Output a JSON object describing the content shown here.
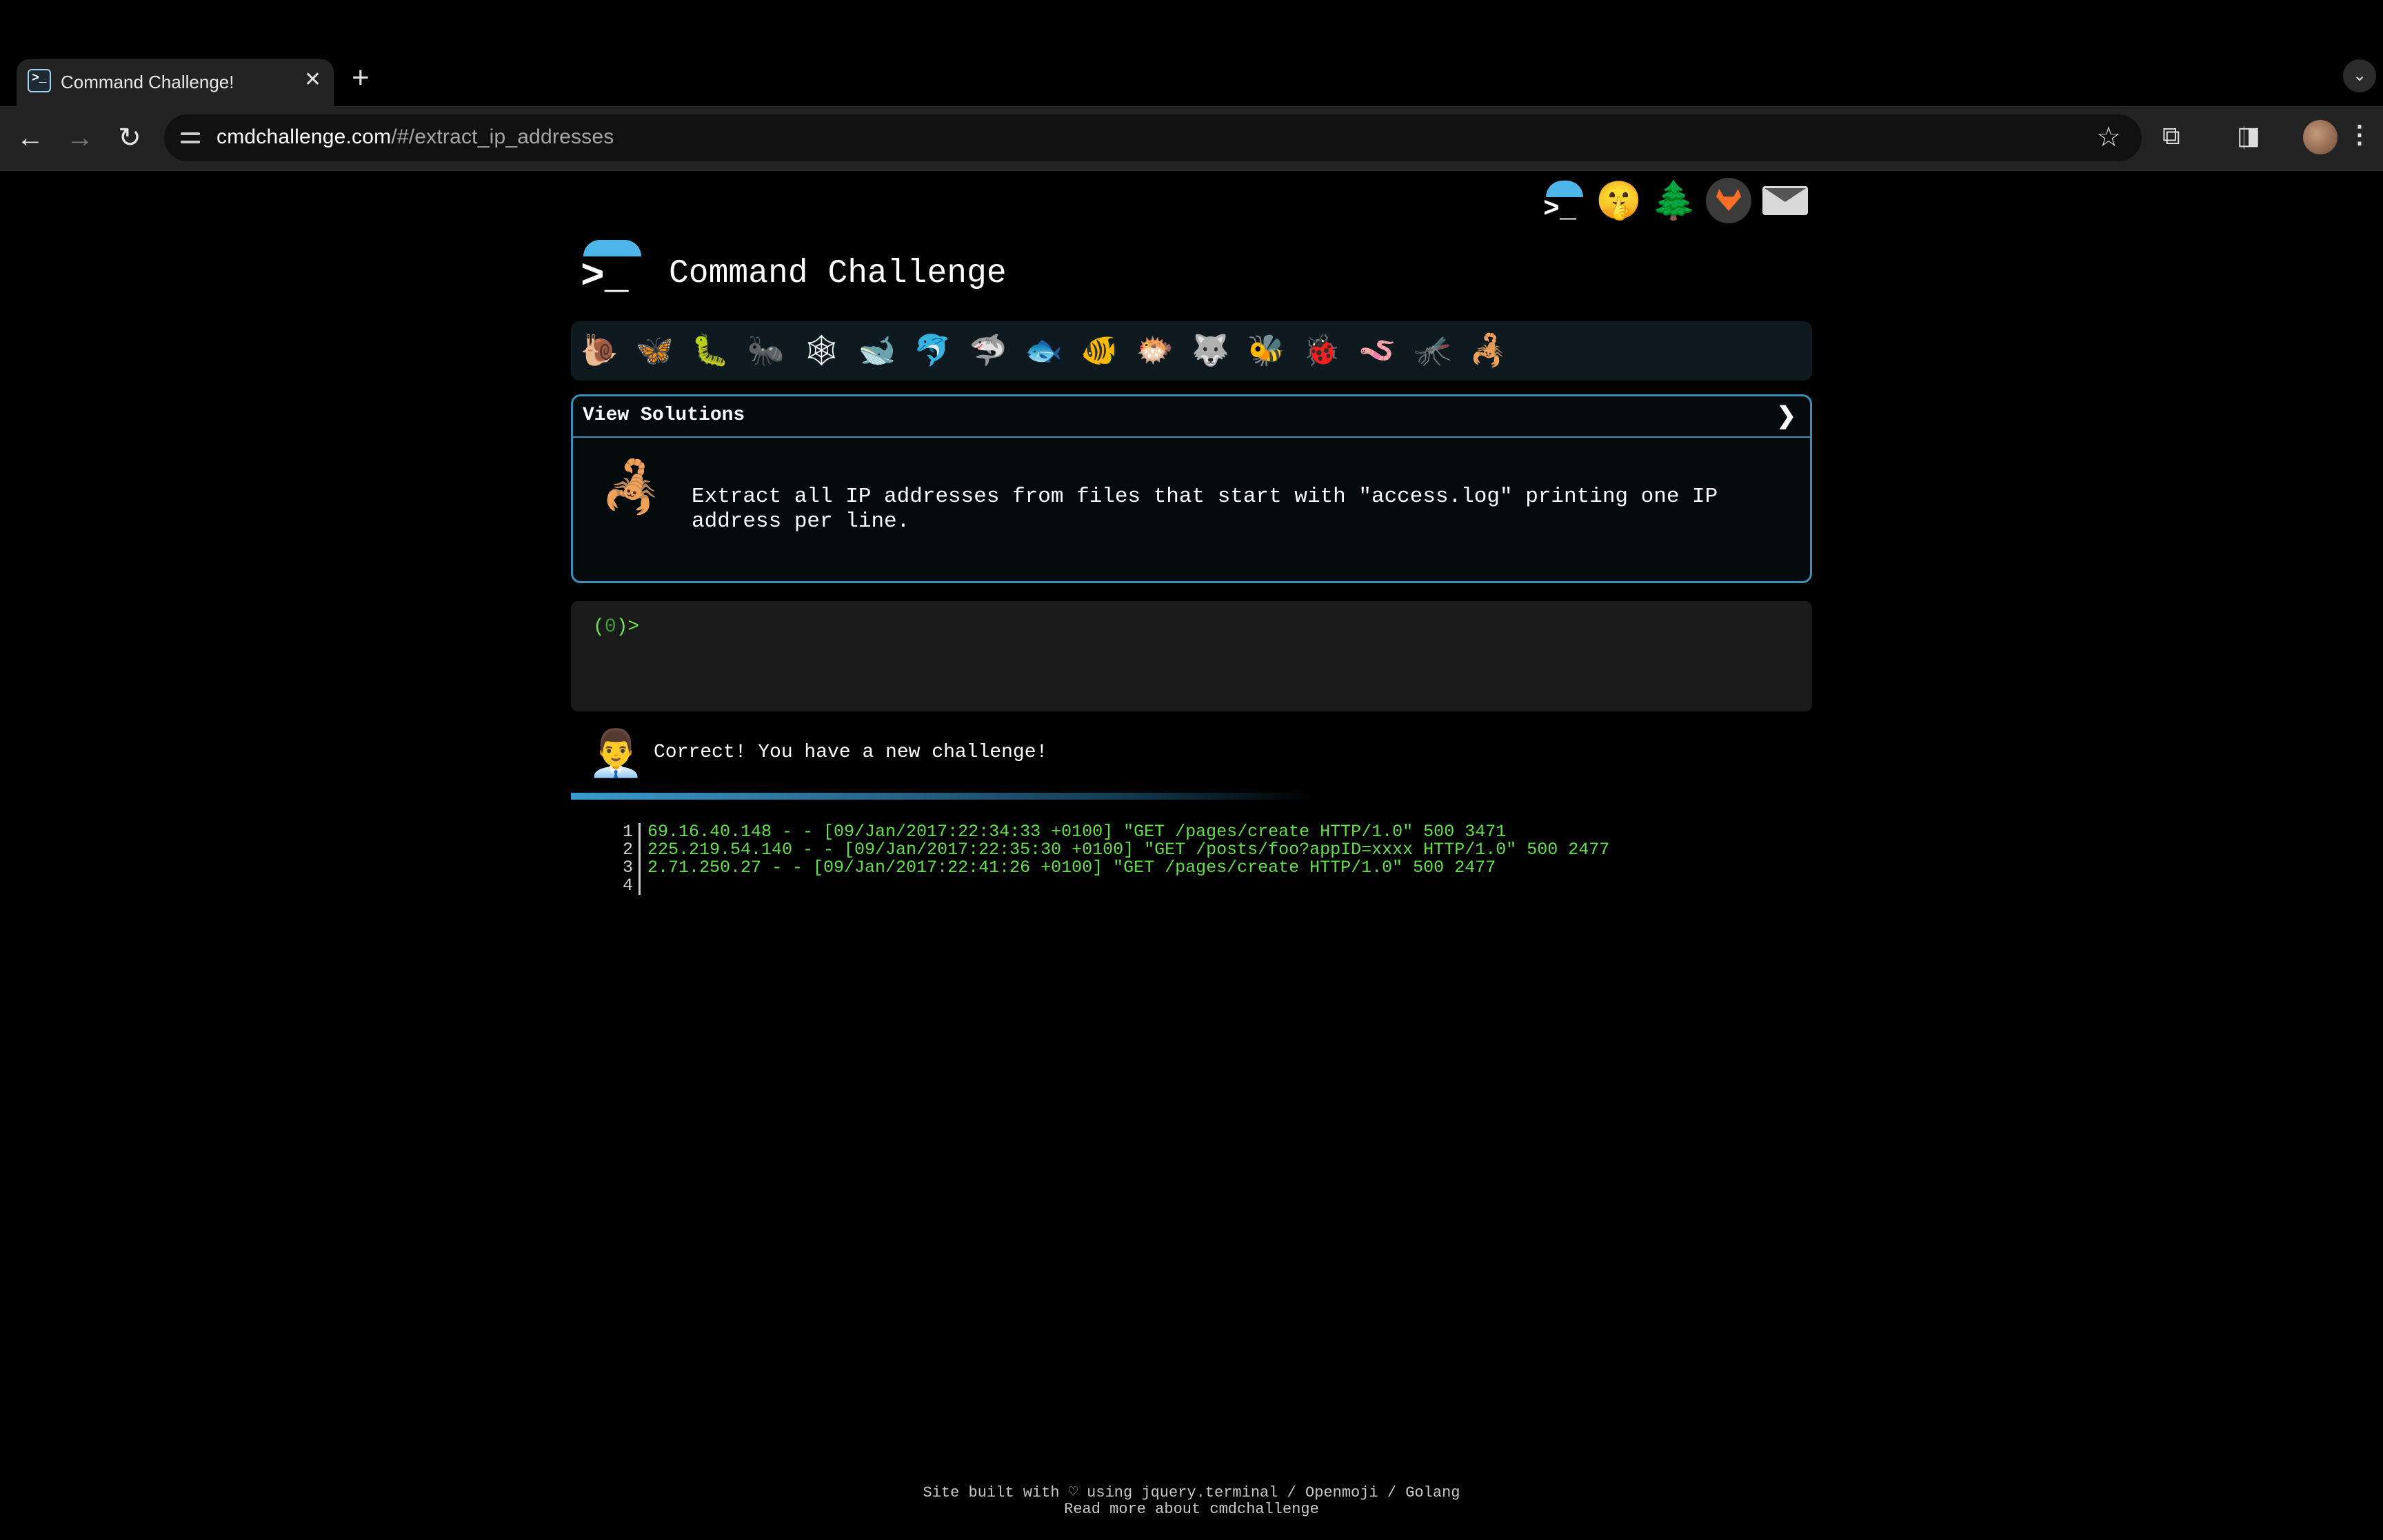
{
  "browser": {
    "tab_title": "Command Challenge!",
    "url_domain": "cmdchallenge.com",
    "url_path": "/#/extract_ip_addresses"
  },
  "header": {
    "site_title": "Command Challenge",
    "logo_text": ">_",
    "top_link_icons": [
      "cmdchallenge-logo-icon",
      "shush-face-icon",
      "tree-icon",
      "gitlab-icon",
      "mail-icon"
    ]
  },
  "challenge_bar": {
    "icons": [
      "snail-icon",
      "butterfly-icon",
      "caterpillar-icon",
      "ant-icon",
      "spider-web-icon",
      "whale-icon",
      "dolphin-icon",
      "shark-icon",
      "fish-icon",
      "tropical-fish-icon",
      "pufferfish-icon",
      "wolf-icon",
      "bee-icon",
      "ladybug-icon",
      "worm-icon",
      "mosquito-icon",
      "scorpion-icon"
    ],
    "glyphs": [
      "🐌",
      "🦋",
      "🐛",
      "🐜",
      "🕸",
      "🐋",
      "🐬",
      "🦈",
      "🐟",
      "🐠",
      "🐡",
      "🐺",
      "🐝",
      "🐞",
      "🪱",
      "🦟",
      "🦂"
    ]
  },
  "solution_panel": {
    "header": "View Solutions",
    "chevron": "❯",
    "challenge_icon": "🦂",
    "description": "Extract all IP addresses from files that start with \"access.log\" printing one IP address per line."
  },
  "terminal": {
    "prompt_open": "(",
    "prompt_count": "0",
    "prompt_close": ")>"
  },
  "feedback": {
    "avatar": "👨‍💼",
    "message": "Correct! You have a new challenge!"
  },
  "output": {
    "lines": [
      {
        "n": "1",
        "text": "69.16.40.148 - - [09/Jan/2017:22:34:33 +0100] \"GET /pages/create HTTP/1.0\" 500 3471"
      },
      {
        "n": "2",
        "text": "225.219.54.140 - - [09/Jan/2017:22:35:30 +0100] \"GET /posts/foo?appID=xxxx HTTP/1.0\" 500 2477"
      },
      {
        "n": "3",
        "text": "2.71.250.27 - - [09/Jan/2017:22:41:26 +0100] \"GET /pages/create HTTP/1.0\" 500 2477"
      },
      {
        "n": "4",
        "text": ""
      }
    ]
  },
  "footer": {
    "line1": "Site built with ♡ using jquery.terminal / Openmoji / Golang",
    "line2": "Read more about cmdchallenge"
  },
  "colors": {
    "accent": "#3b8fb8",
    "terminal_green": "#63e049",
    "background": "#000000"
  }
}
